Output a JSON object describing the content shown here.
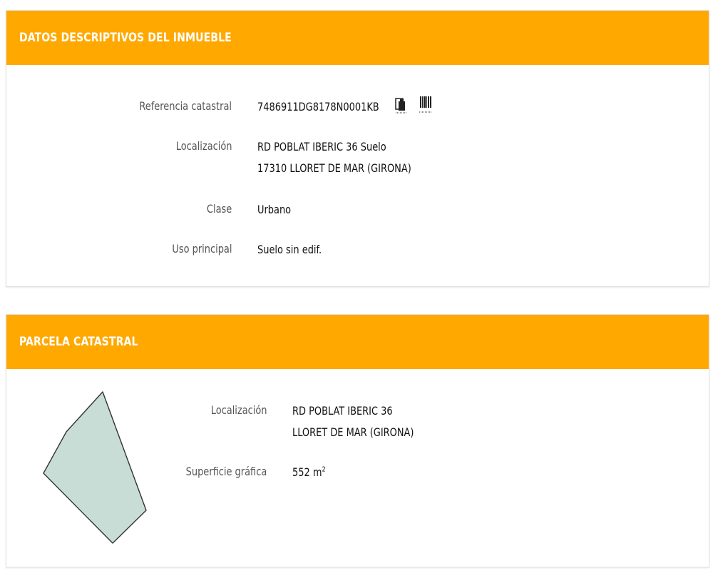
{
  "inmueble": {
    "title": "DATOS DESCRIPTIVOS DEL INMUEBLE",
    "ref_label": "Referencia catastral",
    "ref_value": "7486911DG8178N0001KB",
    "loc_label": "Localización",
    "loc_line1": "RD POBLAT IBERIC 36 Suelo",
    "loc_line2": "17310 LLORET DE MAR (GIRONA)",
    "clase_label": "Clase",
    "clase_value": "Urbano",
    "uso_label": "Uso principal",
    "uso_value": "Suelo sin edif."
  },
  "parcela": {
    "title": "PARCELA CATASTRAL",
    "loc_label": "Localización",
    "loc_line1": "RD POBLAT IBERIC 36",
    "loc_line2": "LLORET DE MAR (GIRONA)",
    "sup_label": "Superficie gráfica",
    "sup_value": "552 m",
    "sup_unit_exp": "2"
  },
  "icons": {
    "copy": "copy-icon",
    "barcode": "barcode-icon"
  },
  "colors": {
    "header": "#ffa800",
    "parcel_fill": "#c8ddd6",
    "parcel_stroke": "#333333"
  }
}
